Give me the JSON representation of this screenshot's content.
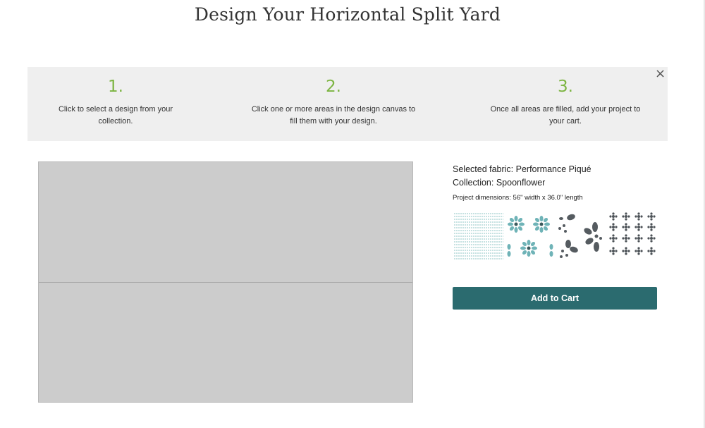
{
  "page": {
    "title": "Design Your Horizontal Split Yard"
  },
  "instructions": {
    "close_icon": "×",
    "steps": [
      {
        "number": "1.",
        "text": "Click to select a design from your collection."
      },
      {
        "number": "2.",
        "text": "Click one or more areas in the design canvas to fill them with your design."
      },
      {
        "number": "3.",
        "text": "Once all areas are filled, add your project to your cart."
      }
    ]
  },
  "details": {
    "selected_fabric": "Selected fabric: Performance Piqué",
    "collection": "Collection: Spoonflower",
    "dimensions": "Project dimensions: 56\" width x 36.0\" length"
  },
  "actions": {
    "add_to_cart": "Add to Cart"
  },
  "swatches": [
    {
      "name": "spoonflower-logo-pattern",
      "color": "#8fc4c6"
    },
    {
      "name": "teal-flower-pattern",
      "color": "#6fb3b7"
    },
    {
      "name": "gray-petal-pattern",
      "color": "#555b60"
    },
    {
      "name": "small-gray-flower-pattern",
      "color": "#4d5358"
    }
  ],
  "colors": {
    "accent": "#7cb441",
    "button": "#2b6b6f",
    "canvas": "#cccccc",
    "banner": "#efefef"
  }
}
